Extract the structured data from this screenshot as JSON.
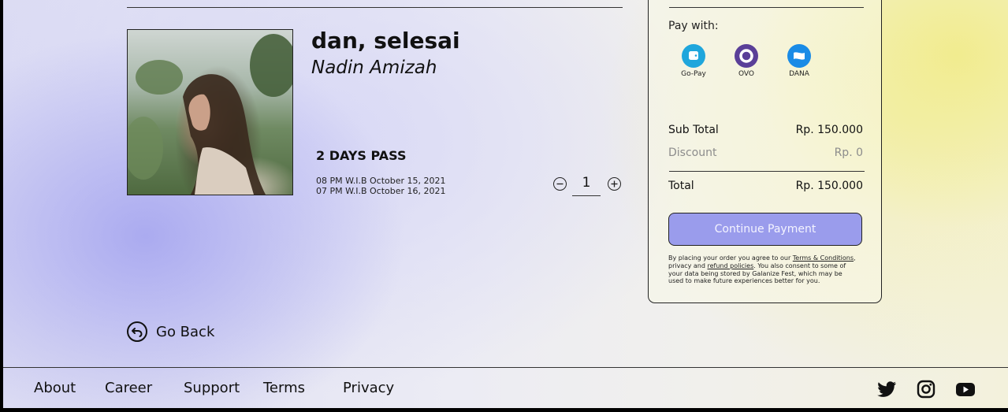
{
  "product": {
    "title": "dan, selesai",
    "artist": "Nadin Amizah",
    "pass_name": "2 DAYS PASS",
    "dates": [
      "08 PM W.I.B October 15, 2021",
      "07 PM W.I.B October 16, 2021"
    ],
    "quantity": "1",
    "image_icon": "album-cover-woman-in-field"
  },
  "checkout": {
    "pay_with_label": "Pay with:",
    "payment_methods": [
      {
        "label": "Go-Pay",
        "icon": "gopay-wallet-icon",
        "color": "#1fa6dc"
      },
      {
        "label": "OVO",
        "icon": "ovo-ring-icon",
        "color": "#5a3f98"
      },
      {
        "label": "DANA",
        "icon": "dana-wallet-icon",
        "color": "#1a8be6"
      }
    ],
    "subtotal_label": "Sub Total",
    "subtotal_value": "Rp. 150.000",
    "discount_label": "Discount",
    "discount_value": "Rp. 0",
    "total_label": "Total",
    "total_value": "Rp. 150.000",
    "button_label": "Continue Payment",
    "button_color": "#9a9cec",
    "legal": {
      "part1": "By placing your order you agree to our ",
      "terms_link": "Terms & Conditions",
      "part2": ", privacy and ",
      "refund_link": "refund policies",
      "part3": ". You also consent to some of your data being stored by Galanize Fest, which may be used to make future experiences better for you."
    }
  },
  "go_back": {
    "label": "Go Back",
    "icon": "back-arrow-circle-icon"
  },
  "footer": {
    "links": [
      "About",
      "Career",
      "Support",
      "Terms",
      "Privacy"
    ],
    "social": [
      "twitter-icon",
      "instagram-icon",
      "youtube-icon"
    ]
  }
}
